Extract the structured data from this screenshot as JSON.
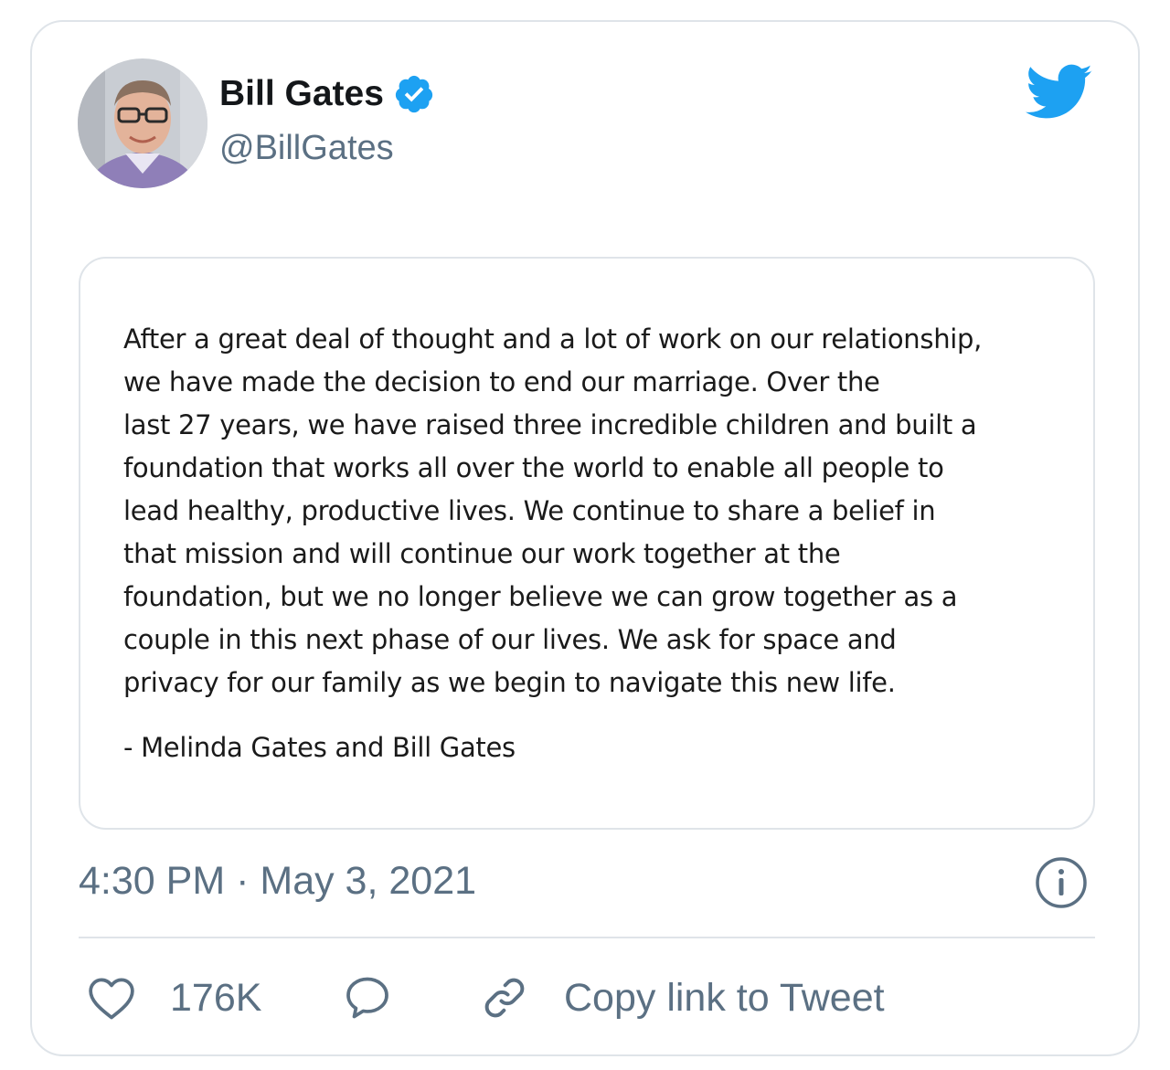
{
  "author": {
    "name": "Bill Gates",
    "handle": "@BillGates",
    "verified_icon": "verified-badge-icon",
    "avatar": "profile-photo"
  },
  "brand": {
    "logo": "twitter-bird-icon",
    "accent_color": "#1da1f2"
  },
  "statement": {
    "lines": [
      "After a great deal of thought and a lot of work on our relationship,",
      "we have made the decision to end our marriage. Over the",
      "last 27 years, we have raised three incredible children and built a",
      "foundation that works all over the world to enable all people to",
      "lead healthy, productive lives. We continue to share a belief in",
      "that mission and will continue our work together at the",
      "foundation, but we no longer believe we can grow together as a",
      "couple in this next phase of our lives. We ask for space and",
      "privacy for our family as we begin to navigate this new life."
    ],
    "signature": "- Melinda Gates and Bill Gates"
  },
  "meta": {
    "time": "4:30 PM",
    "separator": "·",
    "date": "May 3, 2021",
    "info_icon": "info-icon"
  },
  "actions": {
    "like_icon": "heart-icon",
    "like_count": "176K",
    "reply_icon": "reply-bubble-icon",
    "copy_icon": "link-icon",
    "copy_label": "Copy link to Tweet"
  },
  "colors": {
    "text_primary": "#14171a",
    "text_secondary": "#5b7083",
    "border": "#dfe4e9"
  }
}
